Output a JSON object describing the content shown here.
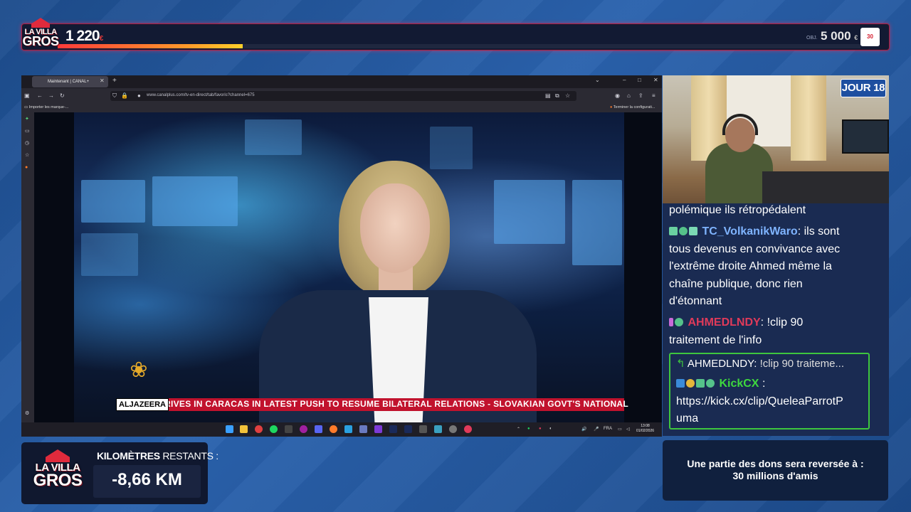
{
  "top_bar": {
    "logo_line1": "LA VILLA",
    "logo_line2": "GROS",
    "amount": "1 220",
    "amount_currency": "€",
    "progress_fraction": 0.23,
    "goal_label": "OBJ.",
    "goal_amount": "5 000",
    "goal_currency": "€",
    "partner_badge": "30"
  },
  "browser": {
    "tab_title": "Maintenant | CANAL+",
    "new_tab": "+",
    "url": "www.canalplus.com/tv-en-direct/tab/favoris?channel=675",
    "bookmark_import": "Importer les marque-...",
    "bookmark_right": "Terminer la configurati...",
    "window_minimize": "–",
    "window_maximize": "□",
    "window_close": "✕",
    "tab_menu": "⌄",
    "video": {
      "channel_brand": "ALJAZEERA",
      "ticker": "RIVES IN CARACAS IN LATEST PUSH TO RESUME BILATERAL RELATIONS   -   SLOVAKIAN GOVT'S NATIONAL"
    },
    "taskbar": {
      "lang": "FRA",
      "time": "13:08",
      "date": "01/02/2026"
    }
  },
  "webcam": {
    "day_badge": "JOUR 18"
  },
  "chat": {
    "messages": [
      {
        "user": "",
        "text": "polémique ils rétropédalent"
      },
      {
        "user": "TC_VolkanikWaro",
        "text": ": ils sont"
      },
      {
        "user": "",
        "text": "tous devenus en convivance avec"
      },
      {
        "user": "",
        "text": "l'extrême droite Ahmed même la"
      },
      {
        "user": "",
        "text": "chaîne publique, donc rien"
      },
      {
        "user": "",
        "text": "d'étonnant"
      },
      {
        "user": "AHMEDLNDY",
        "text": ": !clip 90"
      },
      {
        "user": "",
        "text": "traitement de l'info"
      }
    ],
    "reply": {
      "reply_user": "AHMEDLNDY:",
      "reply_text": "!clip 90 traiteme...",
      "user": "KickCX",
      "sep": ":",
      "link_line1": "https://kick.cx/clip/QueleaParrotP",
      "link_line2": "uma"
    }
  },
  "km": {
    "logo_line1": "LA VILLA",
    "logo_line2": "GROS",
    "label_bold": "KILOMÈTRES",
    "label_thin": "RESTANTS :",
    "value": "-8,66 KM"
  },
  "donation": {
    "line1": "Une partie des dons sera reversée à :",
    "line2": "30 millions d'amis"
  },
  "colors": {
    "accent_red": "#c1122d",
    "chat_bg": "#1a2b52",
    "kick_green": "#3ec63e"
  }
}
